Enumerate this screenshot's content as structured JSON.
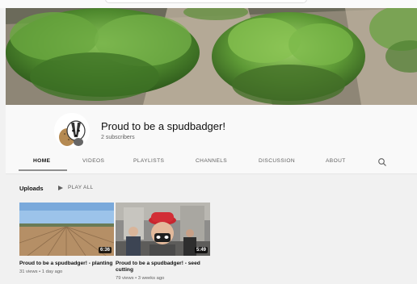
{
  "channel": {
    "title": "Proud to be a spudbadger!",
    "subscribers": "2 subscribers"
  },
  "tabs": [
    {
      "label": "HOME",
      "active": true
    },
    {
      "label": "VIDEOS"
    },
    {
      "label": "PLAYLISTS"
    },
    {
      "label": "CHANNELS"
    },
    {
      "label": "DISCUSSION"
    },
    {
      "label": "ABOUT"
    }
  ],
  "uploads": {
    "label": "Uploads",
    "play_all": "PLAY ALL"
  },
  "videos": [
    {
      "title": "Proud to be a spudbadger! - planting",
      "duration": "6:36",
      "meta": "31 views • 1 day ago"
    },
    {
      "title": "Proud to be a spudbadger! - seed cutting",
      "duration": "5:49",
      "meta": "79 views • 3 weeks ago"
    }
  ],
  "icons": {
    "tab_search": "search-icon",
    "play_all": "play-icon"
  },
  "colors": {
    "page_bg": "#f1f1f1",
    "header_bg": "#f9f9f9",
    "text_primary": "#0f0f0f",
    "text_secondary": "#606060"
  }
}
